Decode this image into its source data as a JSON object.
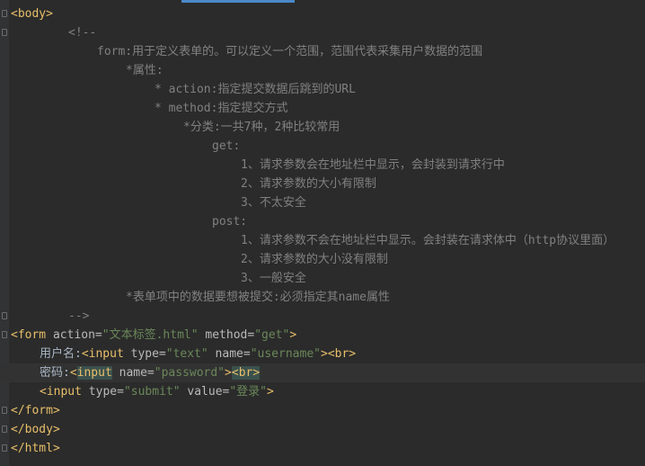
{
  "editor": {
    "lines": [
      {
        "indent": 0,
        "tokens": [
          [
            "tag",
            "<body>"
          ]
        ]
      },
      {
        "indent": 8,
        "tokens": [
          [
            "cmt",
            "<!--"
          ]
        ]
      },
      {
        "indent": 12,
        "tokens": [
          [
            "cmt",
            "form:用于定义表单的。可以定义一个范围，范围代表采集用户数据的范围"
          ]
        ]
      },
      {
        "indent": 16,
        "tokens": [
          [
            "cmt",
            "*属性:"
          ]
        ]
      },
      {
        "indent": 20,
        "tokens": [
          [
            "cmt",
            "* action:指定提交数据后跳到的URL"
          ]
        ]
      },
      {
        "indent": 20,
        "tokens": [
          [
            "cmt",
            "* method:指定提交方式"
          ]
        ]
      },
      {
        "indent": 24,
        "tokens": [
          [
            "cmt",
            "*分类:一共7种，2种比较常用"
          ]
        ]
      },
      {
        "indent": 28,
        "tokens": [
          [
            "cmt",
            "get:"
          ]
        ]
      },
      {
        "indent": 32,
        "tokens": [
          [
            "cmt",
            "1、请求参数会在地址栏中显示，会封装到请求行中"
          ]
        ]
      },
      {
        "indent": 32,
        "tokens": [
          [
            "cmt",
            "2、请求参数的大小有限制"
          ]
        ]
      },
      {
        "indent": 32,
        "tokens": [
          [
            "cmt",
            "3、不太安全"
          ]
        ]
      },
      {
        "indent": 28,
        "tokens": [
          [
            "cmt",
            "post:"
          ]
        ]
      },
      {
        "indent": 32,
        "tokens": [
          [
            "cmt",
            "1、请求参数不会在地址栏中显示。会封装在请求体中（http协议里面）"
          ]
        ]
      },
      {
        "indent": 32,
        "tokens": [
          [
            "cmt",
            "2、请求参数的大小没有限制"
          ]
        ]
      },
      {
        "indent": 32,
        "tokens": [
          [
            "cmt",
            "3、一般安全"
          ]
        ]
      },
      {
        "indent": 16,
        "tokens": [
          [
            "cmt",
            "*表单项中的数据要想被提交:必须指定其name属性"
          ]
        ]
      },
      {
        "indent": 8,
        "tokens": [
          [
            "cmt",
            "-->"
          ]
        ]
      },
      {
        "indent": 0,
        "tokens": [
          [
            "tag",
            "<form "
          ],
          [
            "attr",
            "action="
          ],
          [
            "val",
            "\"文本标签.html\""
          ],
          [
            "attr",
            " method="
          ],
          [
            "val",
            "\"get\""
          ],
          [
            "tag",
            ">"
          ]
        ]
      },
      {
        "indent": 4,
        "tokens": [
          [
            "plain",
            "用户名:"
          ],
          [
            "tag",
            "<input "
          ],
          [
            "attr",
            "type="
          ],
          [
            "val",
            "\"text\""
          ],
          [
            "attr",
            " name="
          ],
          [
            "val",
            "\"username\""
          ],
          [
            "tag",
            ">"
          ],
          [
            "tag",
            "<br>"
          ]
        ]
      },
      {
        "indent": 4,
        "highlight": true,
        "tokens": [
          [
            "plain",
            "密码:"
          ],
          [
            "tag",
            "<"
          ],
          [
            "match",
            "input"
          ],
          [
            "attr",
            " name="
          ],
          [
            "val",
            "\"password\""
          ],
          [
            "tag",
            ">"
          ],
          [
            "match",
            "<br>"
          ]
        ]
      },
      {
        "indent": 4,
        "tokens": [
          [
            "tag",
            "<input "
          ],
          [
            "attr",
            "type="
          ],
          [
            "val",
            "\"submit\""
          ],
          [
            "attr",
            " value="
          ],
          [
            "val",
            "\"登录\""
          ],
          [
            "tag",
            ">"
          ]
        ]
      },
      {
        "indent": 0,
        "tokens": [
          [
            "tag",
            "</form>"
          ]
        ]
      },
      {
        "indent": 0,
        "tokens": [
          [
            "tag",
            "</body>"
          ]
        ]
      },
      {
        "indent": 0,
        "tokens": [
          [
            "tag",
            "</html>"
          ]
        ]
      }
    ]
  }
}
